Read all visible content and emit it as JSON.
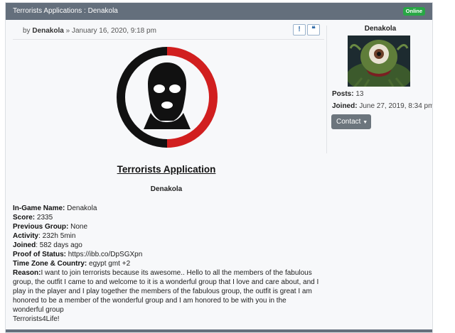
{
  "header": {
    "title": "Terrorists Applications : Denakola",
    "online_badge": "Online"
  },
  "post": {
    "by": "by",
    "author": "Denakola",
    "separator": "»",
    "date": "January 16, 2020, 9:18 pm",
    "report_icon": "exclamation-icon",
    "quote_icon": "quote-icon"
  },
  "content": {
    "title": "Terrorists Application",
    "name": "Denakola",
    "fields": [
      {
        "label": "In-Game Name:",
        "value": " Denakola"
      },
      {
        "label": "Score:",
        "value": " 2335"
      },
      {
        "label": "Previous Group:",
        "value": " None"
      },
      {
        "label": "Activity",
        "value": ": 232h 5min"
      },
      {
        "label": "Joined",
        "value": ": 582 days ago"
      },
      {
        "label": "Proof of Status:",
        "value": " https://ibb.co/DpSGXpn"
      },
      {
        "label": "Time Zone & Country:",
        "value": " egypt gmt +2"
      }
    ],
    "reason_label": "Reason:",
    "reason_lines": [
      "I want to join terrorists because its awesome.. Hello to all the members of the fabulous",
      "group, the outfit I came to and welcome to it is a wonderful group that I love and care about, and I",
      "play in the player and I play together the members of the fabulous group, the outfit is great I am",
      "honored to be a member of the wonderful group and I am honored to be with you in the",
      "wonderful group"
    ],
    "signoff": "Terrorists4Life!"
  },
  "profile": {
    "username": "Denakola",
    "posts_label": "Posts:",
    "posts_value": " 13",
    "joined_label": "Joined:",
    "joined_value": " June 27, 2019, 8:34 pm",
    "contact_label": "Contact",
    "avatar_icon": "monster-avatar-icon"
  },
  "colors": {
    "header_bg": "#646f7c",
    "online": "#28a745",
    "logo_red": "#d11f1f",
    "logo_black": "#111111",
    "button": "#6c757d"
  }
}
